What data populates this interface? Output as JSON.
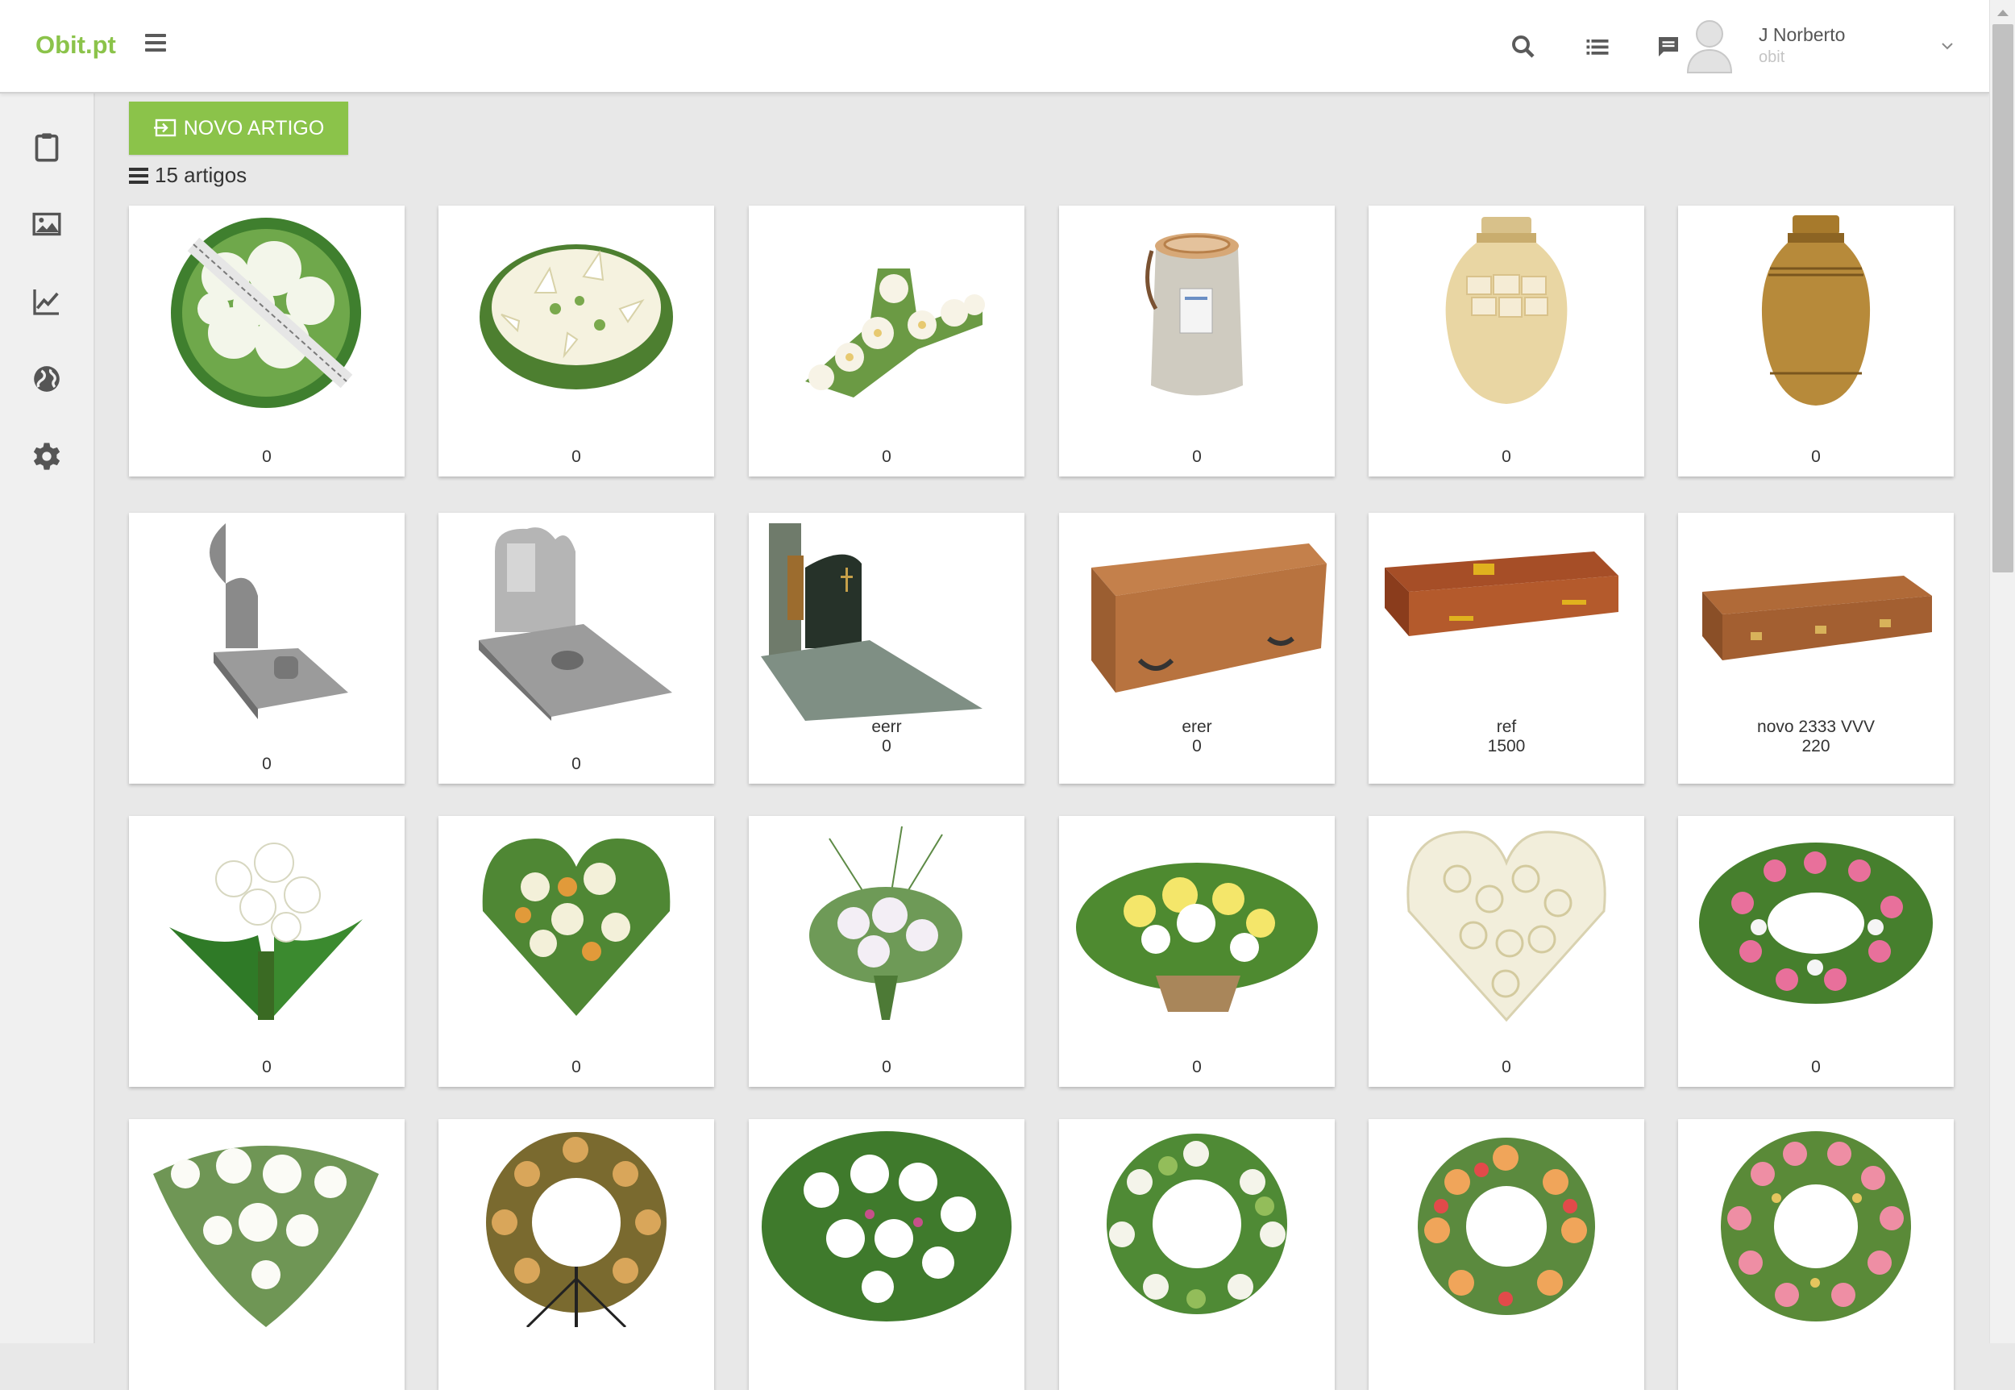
{
  "header": {
    "logo": "Obit.pt",
    "menu_icon": "hamburger-icon",
    "icons": [
      "search-icon",
      "list-icon",
      "chat-icon"
    ],
    "user": {
      "name": "J Norberto",
      "subtitle": "obit"
    }
  },
  "sidebar": {
    "items": [
      "clipboard-icon",
      "image-icon",
      "chart-icon",
      "globe-icon",
      "gear-icon"
    ]
  },
  "toolbar": {
    "new_label": "NOVO ARTIGO",
    "count_label": "15 artigos"
  },
  "colors": {
    "accent": "#8bc34a",
    "background": "#e8e8e8"
  },
  "items": [
    {
      "kind": "flower-wreath-ribbon",
      "label": "",
      "value": "0"
    },
    {
      "kind": "flower-lilies-wreath",
      "label": "",
      "value": "0"
    },
    {
      "kind": "flower-cross",
      "label": "",
      "value": "0"
    },
    {
      "kind": "urn-stone",
      "label": "",
      "value": "0"
    },
    {
      "kind": "urn-cream",
      "label": "",
      "value": "0"
    },
    {
      "kind": "urn-bronze",
      "label": "",
      "value": "0"
    },
    {
      "kind": "tombstone-granite",
      "label": "",
      "value": "0"
    },
    {
      "kind": "tombstone-heart",
      "label": "",
      "value": "0"
    },
    {
      "kind": "tombstone-dark",
      "label": "eerr",
      "value": "0"
    },
    {
      "kind": "coffin-light",
      "label": "erer",
      "value": "0"
    },
    {
      "kind": "coffin-red",
      "label": "ref",
      "value": "1500"
    },
    {
      "kind": "coffin-carved",
      "label": "novo 2333 VVV",
      "value": "220"
    },
    {
      "kind": "bouquet-lilies",
      "label": "",
      "value": "0"
    },
    {
      "kind": "flower-heart-orchids",
      "label": "",
      "value": "0"
    },
    {
      "kind": "bouquet-white",
      "label": "",
      "value": "0"
    },
    {
      "kind": "basket-yellow",
      "label": "",
      "value": "0"
    },
    {
      "kind": "heart-roses",
      "label": "",
      "value": "0"
    },
    {
      "kind": "wreath-pink",
      "label": "",
      "value": "0"
    },
    {
      "kind": "spray-white",
      "label": "",
      "value": ""
    },
    {
      "kind": "wreath-stand",
      "label": "",
      "value": ""
    },
    {
      "kind": "spray-anthurium",
      "label": "",
      "value": ""
    },
    {
      "kind": "wreath-green",
      "label": "",
      "value": ""
    },
    {
      "kind": "wreath-gerbera",
      "label": "",
      "value": ""
    },
    {
      "kind": "wreath-roses",
      "label": "",
      "value": ""
    }
  ]
}
